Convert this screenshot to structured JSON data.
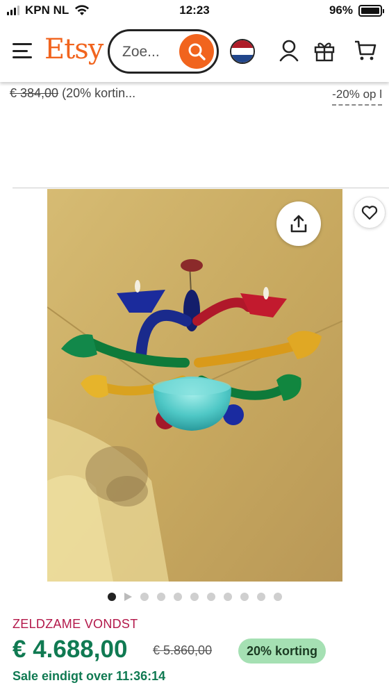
{
  "status_bar": {
    "carrier": "KPN NL",
    "time": "12:23",
    "battery": "96%"
  },
  "header": {
    "logo": "Etsy",
    "search_placeholder": "Zoe...",
    "colors": {
      "brand": "#f1641e"
    }
  },
  "previous_listing": {
    "old_price": "€ 384,00",
    "discount_text": "(20% kortin...",
    "discount_tag": "-20% op l"
  },
  "listing": {
    "image_icon_names": [
      "share-icon",
      "heart-icon"
    ],
    "carousel": {
      "active_index": 0,
      "total": 11,
      "video_index": 1
    },
    "badge": "ZELDZAME VONDST",
    "price": "€ 4.688,00",
    "original_price": "€ 5.860,00",
    "discount": "20% korting",
    "sale_ends": "Sale eindigt over 11:36:14",
    "colors": {
      "price": "#107a52",
      "badge": "#b3184a",
      "discount_bg": "#a5e0b3"
    }
  }
}
